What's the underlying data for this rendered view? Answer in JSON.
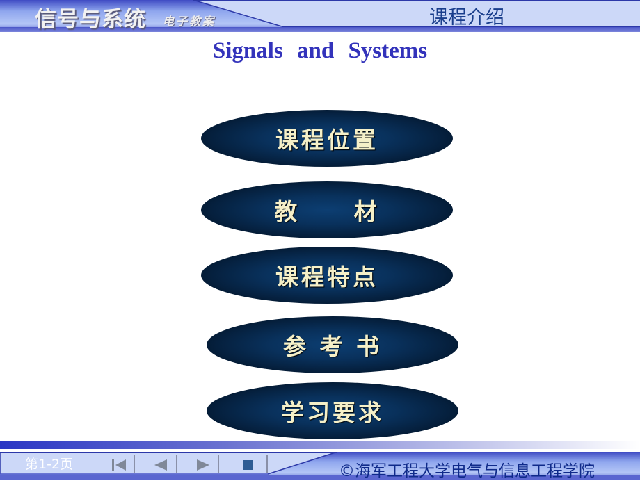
{
  "header": {
    "course_title": "信号与系统",
    "course_subtitle": "电子教案",
    "section_title": "课程介绍"
  },
  "main": {
    "title": "Signals  and  Systems",
    "menu_items": [
      {
        "label": "课程位置"
      },
      {
        "label": "教     材"
      },
      {
        "label": "课程特点"
      },
      {
        "label": "参 考 书"
      },
      {
        "label": "学习要求"
      }
    ]
  },
  "footer": {
    "page_indicator": "第1-2页",
    "nav": {
      "first": "first-page",
      "prev": "previous-page",
      "next": "next-page",
      "stop": "stop"
    },
    "copyright": "©海军工程大学电气与信息工程学院"
  },
  "colors": {
    "header_light": "#ccd8f8",
    "header_dark": "#4a56c8",
    "title_blue": "#3333bb",
    "ellipse_dark": "#05203e",
    "ellipse_text": "#f5f0c8",
    "footer_text": "#0f2a8a",
    "nav_icon": "#808898",
    "stop_icon": "#2e5c94"
  }
}
